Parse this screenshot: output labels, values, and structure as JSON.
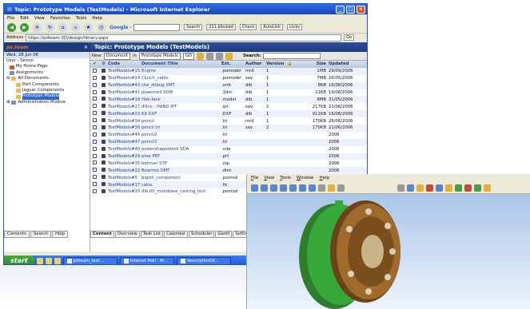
{
  "ie": {
    "title": "Topic: Prototype Models (TestModels) - Microsoft Internet Explorer",
    "menu": [
      "File",
      "Edit",
      "View",
      "Favorites",
      "Tools",
      "Help"
    ],
    "google_label": "Google -",
    "search_btn": "Search",
    "blocked": "211 blocked",
    "check": "Check",
    "autolink": "AutoLink",
    "links": "Links",
    "address_label": "Address",
    "address": "https://pdteam-3D/design/library.aspx",
    "go": "Go"
  },
  "left": {
    "logo": "ps.team",
    "date": "Wed, 28 Jun 06",
    "user": "User : Simon",
    "tree": [
      {
        "label": "My Home Page",
        "icon": "home-icon"
      },
      {
        "label": "Assignments",
        "icon": "assignments-icon"
      },
      {
        "label": "All Documents",
        "icon": "folder-icon"
      },
      {
        "label": "Part Components",
        "icon": "folder-icon"
      },
      {
        "label": "Jaguar Components",
        "icon": "folder-icon"
      },
      {
        "label": "Prototype Models",
        "icon": "folder-icon",
        "selected": true
      },
      {
        "label": "Administration Module",
        "icon": "admin-icon"
      }
    ],
    "tabs": [
      "Contents",
      "Search",
      "Help"
    ]
  },
  "main": {
    "title": "Topic: Prototype Models (TestModels)",
    "new_label": "New",
    "doc_type": "Document",
    "in_label": "in",
    "location": "Prototype Models",
    "go": "GO",
    "search_label": "Search:",
    "headers": [
      "Code",
      "Document Title",
      "Ext.",
      "Author",
      "Version",
      "Size",
      "Updated"
    ],
    "rows": [
      [
        "TestModels#15",
        "Engine",
        ".pomodel",
        "mrd",
        "1",
        "1MB",
        "29/09/2006"
      ],
      [
        "TestModels#14",
        "Clutch_cable",
        ".pomodel",
        "sav",
        "1",
        "7MB",
        "26/05/2006"
      ],
      [
        "TestModels#43",
        "ctw_debug XMT",
        ".xmt",
        "dib",
        "1",
        "8KB",
        "16/06/2006"
      ],
      [
        "TestModels#41",
        "powercell 3DM",
        ".3dm",
        "dib",
        "1",
        "11KB",
        "19/06/2006"
      ],
      [
        "TestModels#18",
        "Hob-face",
        ".model",
        "dib",
        "1",
        "8MB",
        "31/05/2006"
      ],
      [
        "TestModels#27",
        "iPilco - HAND IPT",
        ".ipt",
        "sav",
        "2",
        "217KB",
        "21/06/2006"
      ],
      [
        "TestModels#23",
        "K9 DXF",
        ".DXF",
        "dib",
        "1",
        "911KB",
        "16/06/2006"
      ],
      [
        "TestModels#34",
        "pencil",
        ".tri",
        "mrd",
        "1",
        "170KB",
        "28/06/2006"
      ],
      [
        "TestModels#36",
        "pencil tri",
        ".tri",
        "sav",
        "2",
        "170KB",
        "21/06/2006"
      ],
      [
        "TestModels#45",
        "pencil2",
        ".tri",
        "",
        "",
        "",
        "2006"
      ],
      [
        "TestModels#47",
        "pencil3",
        ".tri",
        "",
        "",
        "",
        "2006"
      ],
      [
        "TestModels#40",
        "powershapeblock VDA",
        ".vda",
        "",
        "",
        "",
        "2006"
      ],
      [
        "TestModels#29",
        "proe PRT",
        ".prt",
        "",
        "",
        "",
        "2006"
      ],
      [
        "TestModels#35",
        "batman STP",
        ".stp",
        "",
        "",
        "",
        "2006"
      ],
      [
        "TestModels#22",
        "Bearhex DMT",
        ".dmt",
        "",
        "",
        "",
        "2006"
      ],
      [
        "TestModels#5",
        "bigish_component",
        ".pomod",
        "",
        "",
        "",
        "2006"
      ],
      [
        "TestModels#17",
        "catia",
        ".fic",
        "",
        "",
        "",
        "2006"
      ],
      [
        "TestModels#20",
        "dib.00_motobase_casting_test",
        ".pomod",
        "",
        "",
        "",
        "2006"
      ]
    ],
    "tabs": [
      "Content",
      "Overview",
      "Task List",
      "Calendar",
      "Scheduler",
      "Gantt",
      "Settings"
    ]
  },
  "taskbar": {
    "start": "start",
    "tasks": [
      "pdteam_test...",
      "Internal Mail - M...",
      "descriptionOf..."
    ]
  },
  "cad": {
    "menu": [
      "File",
      "View",
      "Tools",
      "Window",
      "Help"
    ]
  },
  "colors": {
    "ie_blue": "#2b6be8",
    "app_header": "#1e3d82",
    "selected": "#3069cc",
    "part_green": "#37a93a",
    "part_brown": "#8a5a1e",
    "start_green": "#3a9a32"
  }
}
